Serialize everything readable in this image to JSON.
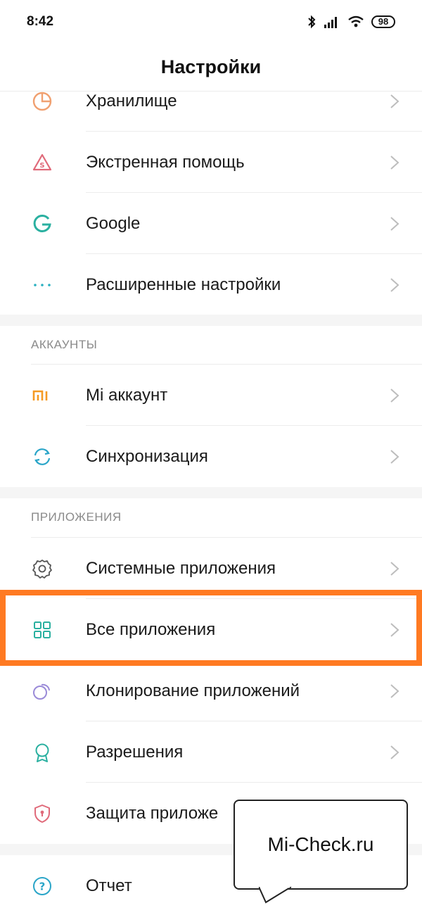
{
  "statusbar": {
    "time": "8:42",
    "battery": "98"
  },
  "header": {
    "title": "Настройки"
  },
  "rows_top": [
    {
      "label": "Хранилище",
      "icon": "storage-icon",
      "color": "#f0a070"
    },
    {
      "label": "Экстренная помощь",
      "icon": "emergency-icon",
      "color": "#e06a7a"
    },
    {
      "label": "Google",
      "icon": "google-icon",
      "color": "#2ab0a0"
    },
    {
      "label": "Расширенные настройки",
      "icon": "more-icon",
      "color": "#2ab0c0"
    }
  ],
  "sections": {
    "accounts": {
      "title": "АККАУНТЫ",
      "items": [
        {
          "label": "Mi аккаунт",
          "icon": "mi-logo-icon",
          "color": "#f59a23"
        },
        {
          "label": "Синхронизация",
          "icon": "sync-icon",
          "color": "#2aa5c8"
        }
      ]
    },
    "apps": {
      "title": "ПРИЛОЖЕНИЯ",
      "items": [
        {
          "label": "Системные приложения",
          "icon": "gear-icon",
          "color": "#555555"
        },
        {
          "label": "Все приложения",
          "icon": "grid-icon",
          "color": "#2ab0a0"
        },
        {
          "label": "Клонирование приложений",
          "icon": "clone-icon",
          "color": "#9a8ad8"
        },
        {
          "label": "Разрешения",
          "icon": "badge-icon",
          "color": "#2ab0a0"
        },
        {
          "label": "Защита приложе",
          "icon": "shield-icon",
          "color": "#e06a7a"
        }
      ]
    },
    "last": {
      "items": [
        {
          "label": "Отчет",
          "icon": "help-icon",
          "color": "#2aa5c8"
        }
      ]
    }
  },
  "overlay": {
    "bubble_text": "Mi-Check.ru",
    "highlight_color": "#ff7a22"
  }
}
